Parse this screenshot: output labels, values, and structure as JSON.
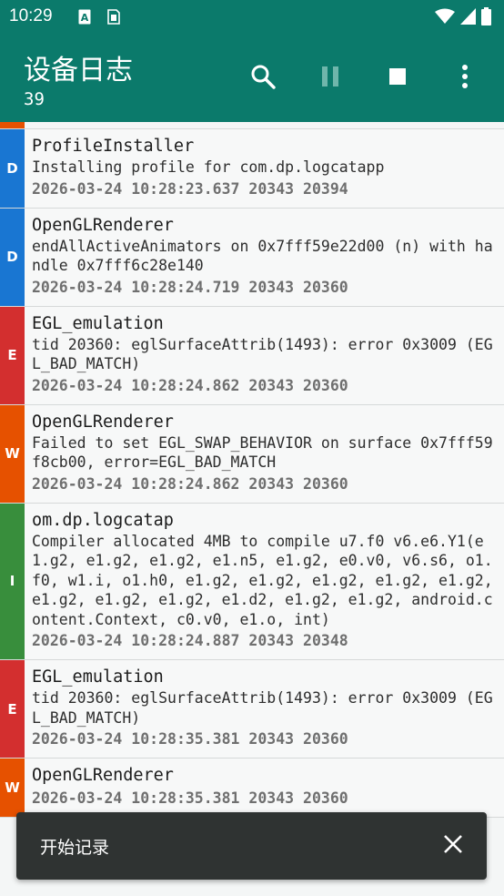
{
  "status_bar": {
    "time": "10:29",
    "note_icons": [
      "a-badge-icon",
      "sim-card-icon"
    ],
    "right_icons": [
      "wifi-icon",
      "signal-icon",
      "battery-icon"
    ]
  },
  "app_bar": {
    "title": "设备日志",
    "count": "39",
    "actions": [
      "search-icon",
      "pause-icon",
      "stop-icon",
      "more-vert-icon"
    ]
  },
  "colors": {
    "primary": "#0b7a6b",
    "level_D": "#1976d2",
    "level_E": "#d32f2f",
    "level_W": "#e65100",
    "level_I": "#388e3c"
  },
  "logs": [
    {
      "level": "D",
      "tag": "ProfileInstaller",
      "message": "Installing profile for com.dp.logcatapp",
      "meta": "2026-03-24 10:28:23.637 20343 20394"
    },
    {
      "level": "D",
      "tag": "OpenGLRenderer",
      "message": "endAllActiveAnimators on 0x7fff59e22d00 (n) with handle 0x7fff6c28e140",
      "meta": "2026-03-24 10:28:24.719 20343 20360"
    },
    {
      "level": "E",
      "tag": "EGL_emulation",
      "message": "tid 20360: eglSurfaceAttrib(1493): error 0x3009 (EGL_BAD_MATCH)",
      "meta": "2026-03-24 10:28:24.862 20343 20360"
    },
    {
      "level": "W",
      "tag": "OpenGLRenderer",
      "message": "Failed to set EGL_SWAP_BEHAVIOR on surface 0x7fff59f8cb00, error=EGL_BAD_MATCH",
      "meta": "2026-03-24 10:28:24.862 20343 20360"
    },
    {
      "level": "I",
      "tag": "om.dp.logcatap",
      "message": "Compiler allocated 4MB to compile u7.f0 v6.e6.Y1(e1.g2, e1.g2, e1.g2, e1.n5, e1.g2, e0.v0, v6.s6, o1.f0, w1.i, o1.h0, e1.g2, e1.g2, e1.g2, e1.g2, e1.g2, e1.g2, e1.g2, e1.g2, e1.d2, e1.g2, e1.g2, android.content.Context, c0.v0, e1.o, int)",
      "meta": "2026-03-24 10:28:24.887 20343 20348"
    },
    {
      "level": "E",
      "tag": "EGL_emulation",
      "message": "tid 20360: eglSurfaceAttrib(1493): error 0x3009 (EGL_BAD_MATCH)",
      "meta": "2026-03-24 10:28:35.381 20343 20360"
    },
    {
      "level": "W",
      "tag": "OpenGLRenderer",
      "message": "",
      "meta": "2026-03-24 10:28:35.381 20343 20360"
    }
  ],
  "snackbar": {
    "text": "开始记录",
    "close_icon": "close-icon"
  }
}
